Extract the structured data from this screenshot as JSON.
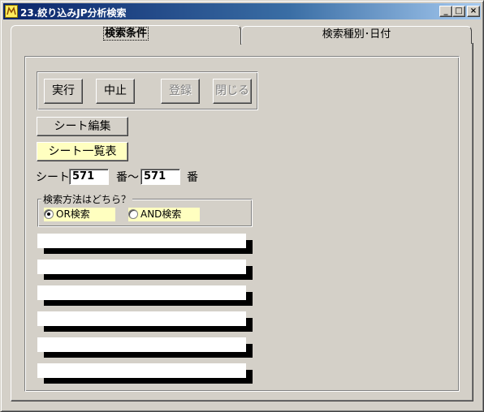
{
  "window": {
    "title": "23.絞り込みJP分析検索",
    "min_glyph": "_",
    "max_glyph": "□",
    "close_glyph": "×"
  },
  "tabs": [
    {
      "label": "検索条件",
      "active": true
    },
    {
      "label": "検索種別･日付",
      "active": false
    }
  ],
  "buttons": {
    "run": "実行",
    "stop": "中止",
    "register": "登録",
    "close": "閉じる",
    "sheet_edit": "シート編集",
    "sheet_list": "シート一覧表"
  },
  "sheet_range": {
    "prefix": "シート",
    "from": "571",
    "middle": "番～",
    "to": "571",
    "suffix": "番"
  },
  "search_mode": {
    "legend": "検索方法はどちら？",
    "options": [
      {
        "label": "OR検索",
        "selected": true
      },
      {
        "label": "AND検索",
        "selected": false
      }
    ]
  },
  "colors": {
    "title_gradient_start": "#0a246a",
    "title_gradient_end": "#a6caf0",
    "highlight_yellow": "#ffffc0",
    "face": "#d4d0c8"
  }
}
